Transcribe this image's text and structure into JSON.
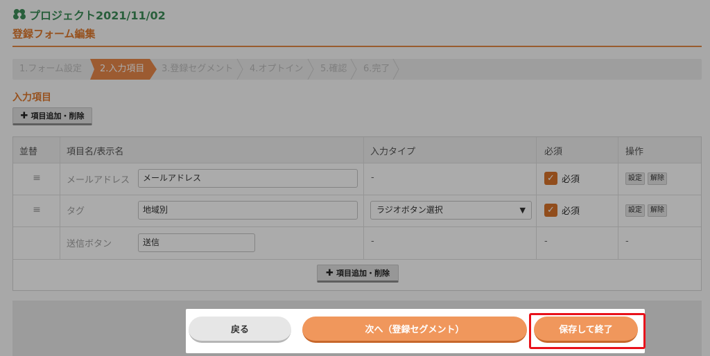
{
  "header": {
    "project_title": "プロジェクト2021/11/02",
    "page_title": "登録フォーム編集"
  },
  "steps": [
    {
      "label": "1.フォーム設定",
      "active": false
    },
    {
      "label": "2.入力項目",
      "active": true
    },
    {
      "label": "3.登録セグメント",
      "active": false
    },
    {
      "label": "4.オプトイン",
      "active": false
    },
    {
      "label": "5.確認",
      "active": false
    },
    {
      "label": "6.完了",
      "active": false
    }
  ],
  "section": {
    "heading": "入力項目",
    "add_remove_label": "項目追加・削除"
  },
  "table": {
    "headers": {
      "order": "並替",
      "name": "項目名/表示名",
      "input_type": "入力タイプ",
      "required": "必須",
      "actions": "操作"
    },
    "rows": [
      {
        "label": "メールアドレス",
        "display_value": "メールアドレス",
        "input_type": "-",
        "required_label": "必須",
        "settings": "設定",
        "remove": "解除"
      },
      {
        "label": "タグ",
        "display_value": "地域別",
        "input_type": "ラジオボタン選択",
        "required_label": "必須",
        "settings": "設定",
        "remove": "解除"
      },
      {
        "label": "送信ボタン",
        "display_value": "送信",
        "input_type": "-",
        "required": "-",
        "actions": "-"
      }
    ],
    "add_remove_label": "項目追加・削除"
  },
  "footer": {
    "back_label": "戻る",
    "next_label": "次へ（登録セグメント）",
    "save_label": "保存して終了"
  },
  "colors": {
    "accent": "#e9884a",
    "title_green": "#3e8e5a",
    "highlight": "#e8111a"
  }
}
